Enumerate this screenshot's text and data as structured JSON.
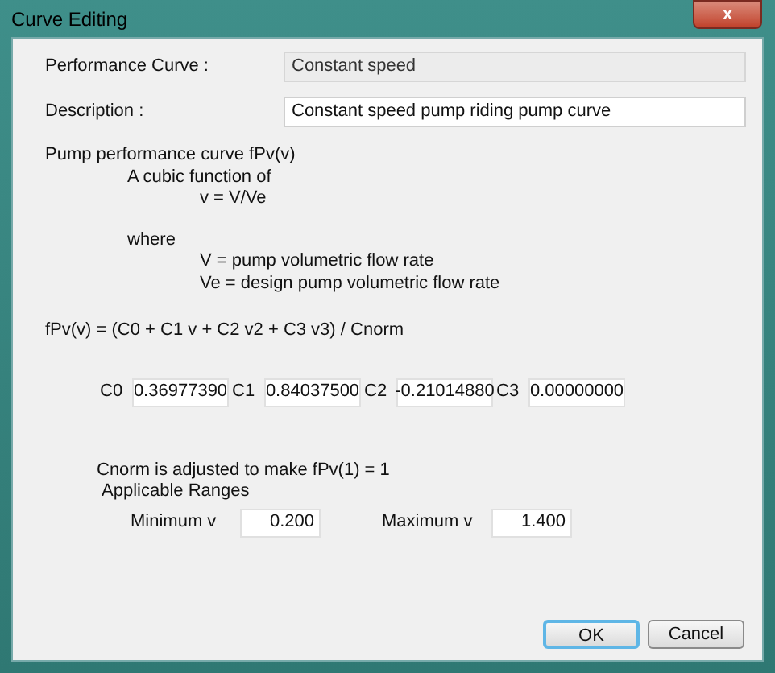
{
  "window": {
    "title": "Curve Editing",
    "close": "x"
  },
  "fields": [
    {
      "label": "Performance Curve :",
      "value": "Constant speed",
      "disabled": true
    },
    {
      "label": "Description :",
      "value": "Constant speed pump riding pump curve",
      "disabled": false
    }
  ],
  "intro": {
    "heading": "Pump performance curve fPv(v)",
    "line_1": "A cubic function of",
    "line_2": "v = V/Ve",
    "where": "where",
    "def_1": "V = pump volumetric flow rate",
    "def_2": "Ve = design pump volumetric flow rate"
  },
  "formula": "fPv(v) = (C0 + C1 v + C2 v2 + C3 v3) / Cnorm",
  "coefficients": [
    {
      "label": "C0",
      "value": "0.36977390"
    },
    {
      "label": "C1",
      "value": "0.84037500"
    },
    {
      "label": "C2",
      "value": "-0.21014880"
    },
    {
      "label": "C3",
      "value": "0.00000000"
    }
  ],
  "note": "Cnorm is adjusted to make fPv(1) = 1",
  "ranges": {
    "title": "Applicable Ranges",
    "items": [
      {
        "label": "Minimum v",
        "value": "0.200"
      },
      {
        "label": "Maximum v",
        "value": "1.400"
      }
    ]
  },
  "buttons": [
    {
      "label": "OK",
      "default": true
    },
    {
      "label": "Cancel",
      "default": false
    }
  ]
}
